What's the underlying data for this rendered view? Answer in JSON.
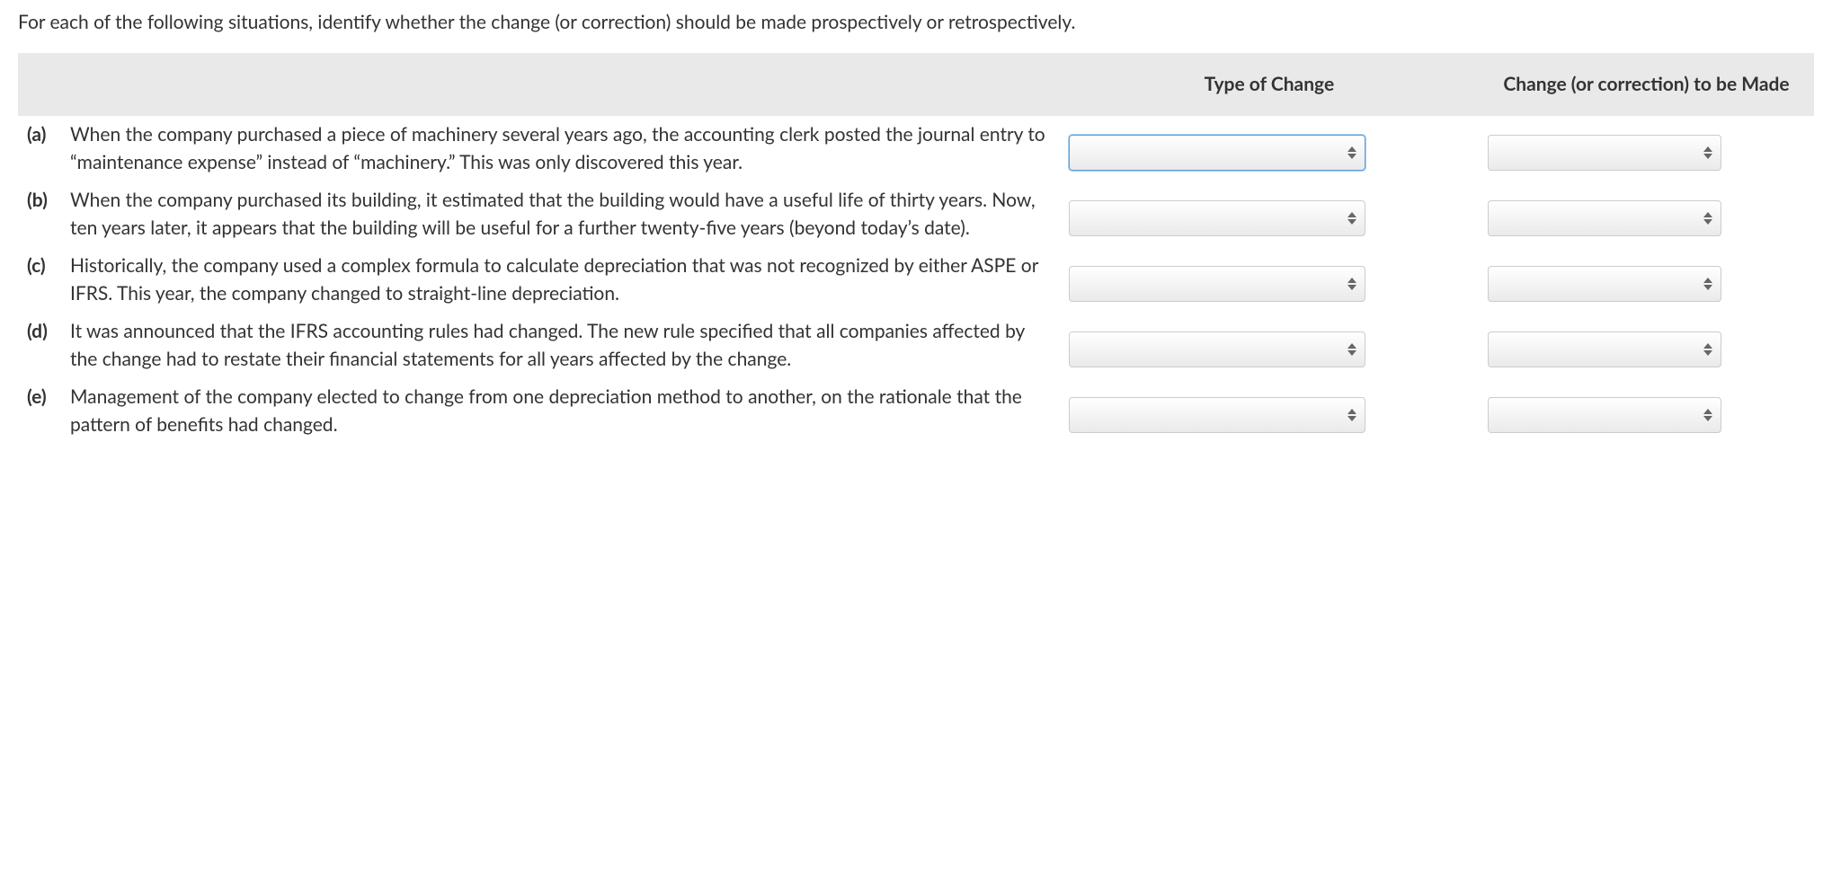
{
  "instruction": "For each of the following situations, identify whether the change (or correction) should be made prospectively or retrospectively.",
  "headers": {
    "description": "",
    "type_of_change": "Type of Change",
    "correction": "Change (or correction) to be Made"
  },
  "items": [
    {
      "label": "(a)",
      "text": "When the company purchased a piece of machinery several years ago, the accounting clerk posted the journal entry to “maintenance expense” instead of “machinery.” This was only discovered this year."
    },
    {
      "label": "(b)",
      "text": "When the company purchased its building, it estimated that the building would have a useful life of thirty years. Now, ten years later, it appears that the building will be useful for a further twenty-five years (beyond today’s date)."
    },
    {
      "label": "(c)",
      "text": "Historically, the company used a complex formula to calculate depreciation that was not recognized by either ASPE or IFRS. This year, the company changed to straight-line depreciation."
    },
    {
      "label": "(d)",
      "text": "It was announced that the IFRS accounting rules had changed. The new rule specified that all companies affected by the change had to restate their financial statements for all years affected by the change."
    },
    {
      "label": "(e)",
      "text": "Management of the company elected to change from one depreciation method to another, on the rationale that the pattern of benefits had changed."
    }
  ]
}
